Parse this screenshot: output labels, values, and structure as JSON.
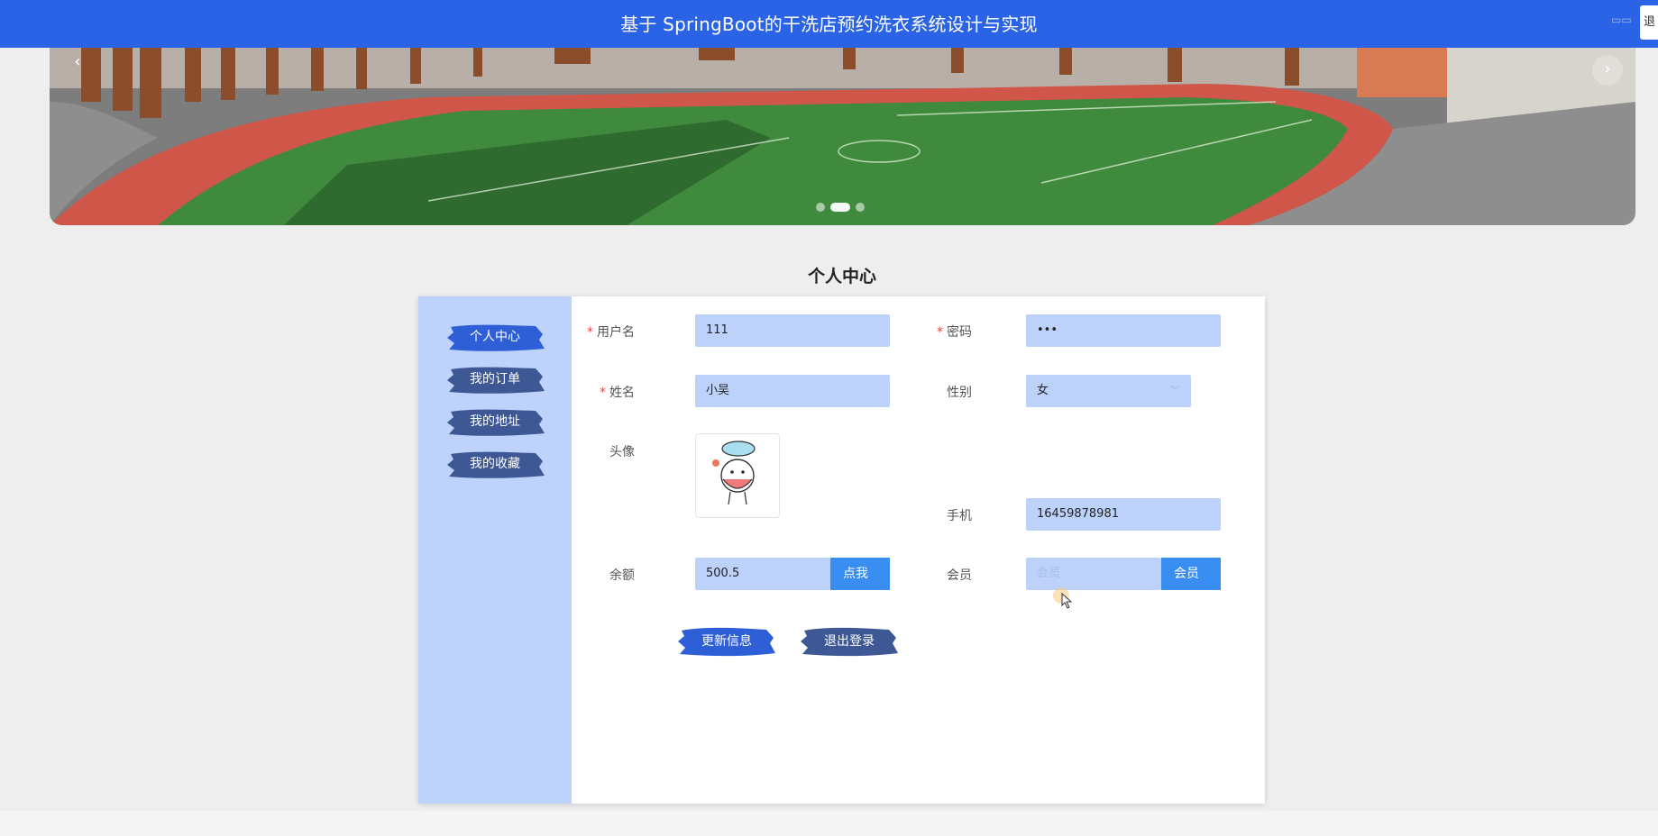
{
  "header": {
    "title": "基于 SpringBoot的干洗店预约洗衣系统设计与实现",
    "logout_mini_label": "退"
  },
  "banner": {
    "prev_label": "‹",
    "next_label": "›",
    "slide_count": 3,
    "active_slide": 2
  },
  "page": {
    "title": "个人中心"
  },
  "sidebar": {
    "items": [
      {
        "label": "个人中心"
      },
      {
        "label": "我的订单"
      },
      {
        "label": "我的地址"
      },
      {
        "label": "我的收藏"
      }
    ]
  },
  "form": {
    "username": {
      "label": "用户名",
      "required_mark": "*",
      "value": "111"
    },
    "password": {
      "label": "密码",
      "required_mark": "*",
      "value": "•••"
    },
    "name": {
      "label": "姓名",
      "required_mark": "*",
      "value": "小吴"
    },
    "gender": {
      "label": "性别",
      "value": "女"
    },
    "avatar": {
      "label": "头像"
    },
    "phone": {
      "label": "手机",
      "value": "16459878981"
    },
    "balance": {
      "label": "余额",
      "value": "500.5",
      "button_label": "点我"
    },
    "member": {
      "label": "会员",
      "placeholder": "会员",
      "button_label": "会员"
    }
  },
  "actions": {
    "update_label": "更新信息",
    "logout_label": "退出登录"
  },
  "colors": {
    "topbar": "#2a63e6",
    "sidebar_bg": "#bdd3fb",
    "input_bg": "#bcd2fb",
    "addon_btn": "#3a8ef2",
    "brush_blue": "#2f5fd7",
    "brush_slate": "#3e5795",
    "required": "#e24b4b"
  }
}
